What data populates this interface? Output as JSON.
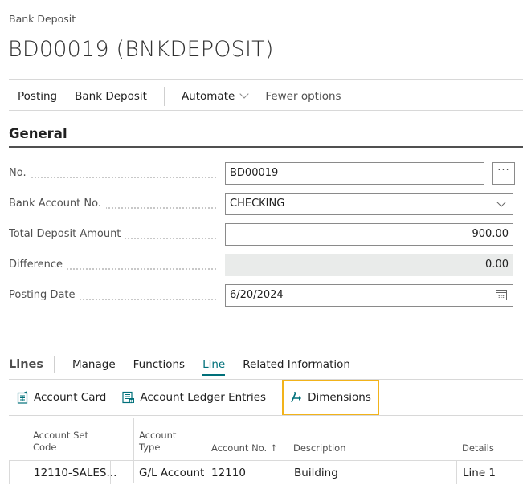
{
  "breadcrumb": "Bank Deposit",
  "title": "BD00019 (BNKDEPOSIT)",
  "action_bar": {
    "items": [
      "Posting",
      "Bank Deposit"
    ],
    "automate_label": "Automate",
    "fewer_options_label": "Fewer options"
  },
  "general": {
    "title": "General",
    "fields": {
      "no": {
        "label": "No.",
        "value": "BD00019",
        "assist": "···"
      },
      "bank_account_no": {
        "label": "Bank Account No.",
        "value": "CHECKING"
      },
      "total_deposit_amount": {
        "label": "Total Deposit Amount",
        "value": "900.00"
      },
      "difference": {
        "label": "Difference",
        "value": "0.00"
      },
      "posting_date": {
        "label": "Posting Date",
        "value": "6/20/2024"
      }
    }
  },
  "lines": {
    "title": "Lines",
    "tabs": [
      "Manage",
      "Functions",
      "Line",
      "Related Information"
    ],
    "active_tab": "Line",
    "actions": [
      "Account Card",
      "Account Ledger Entries",
      "Dimensions"
    ],
    "focused_action": "Dimensions",
    "focus_color": "#f2b31a",
    "accent_color": "#00707a",
    "columns": {
      "account_set_code": [
        "Account Set",
        "Code"
      ],
      "account_type": [
        "Account",
        "Type"
      ],
      "account_no": "Account No. ↑",
      "description": "Description",
      "details": "Details"
    },
    "rows": [
      {
        "account_set_code": "12110-SALES...",
        "account_type": "G/L Account",
        "account_no": "12110",
        "description": "Building",
        "details": "Line 1"
      }
    ]
  }
}
